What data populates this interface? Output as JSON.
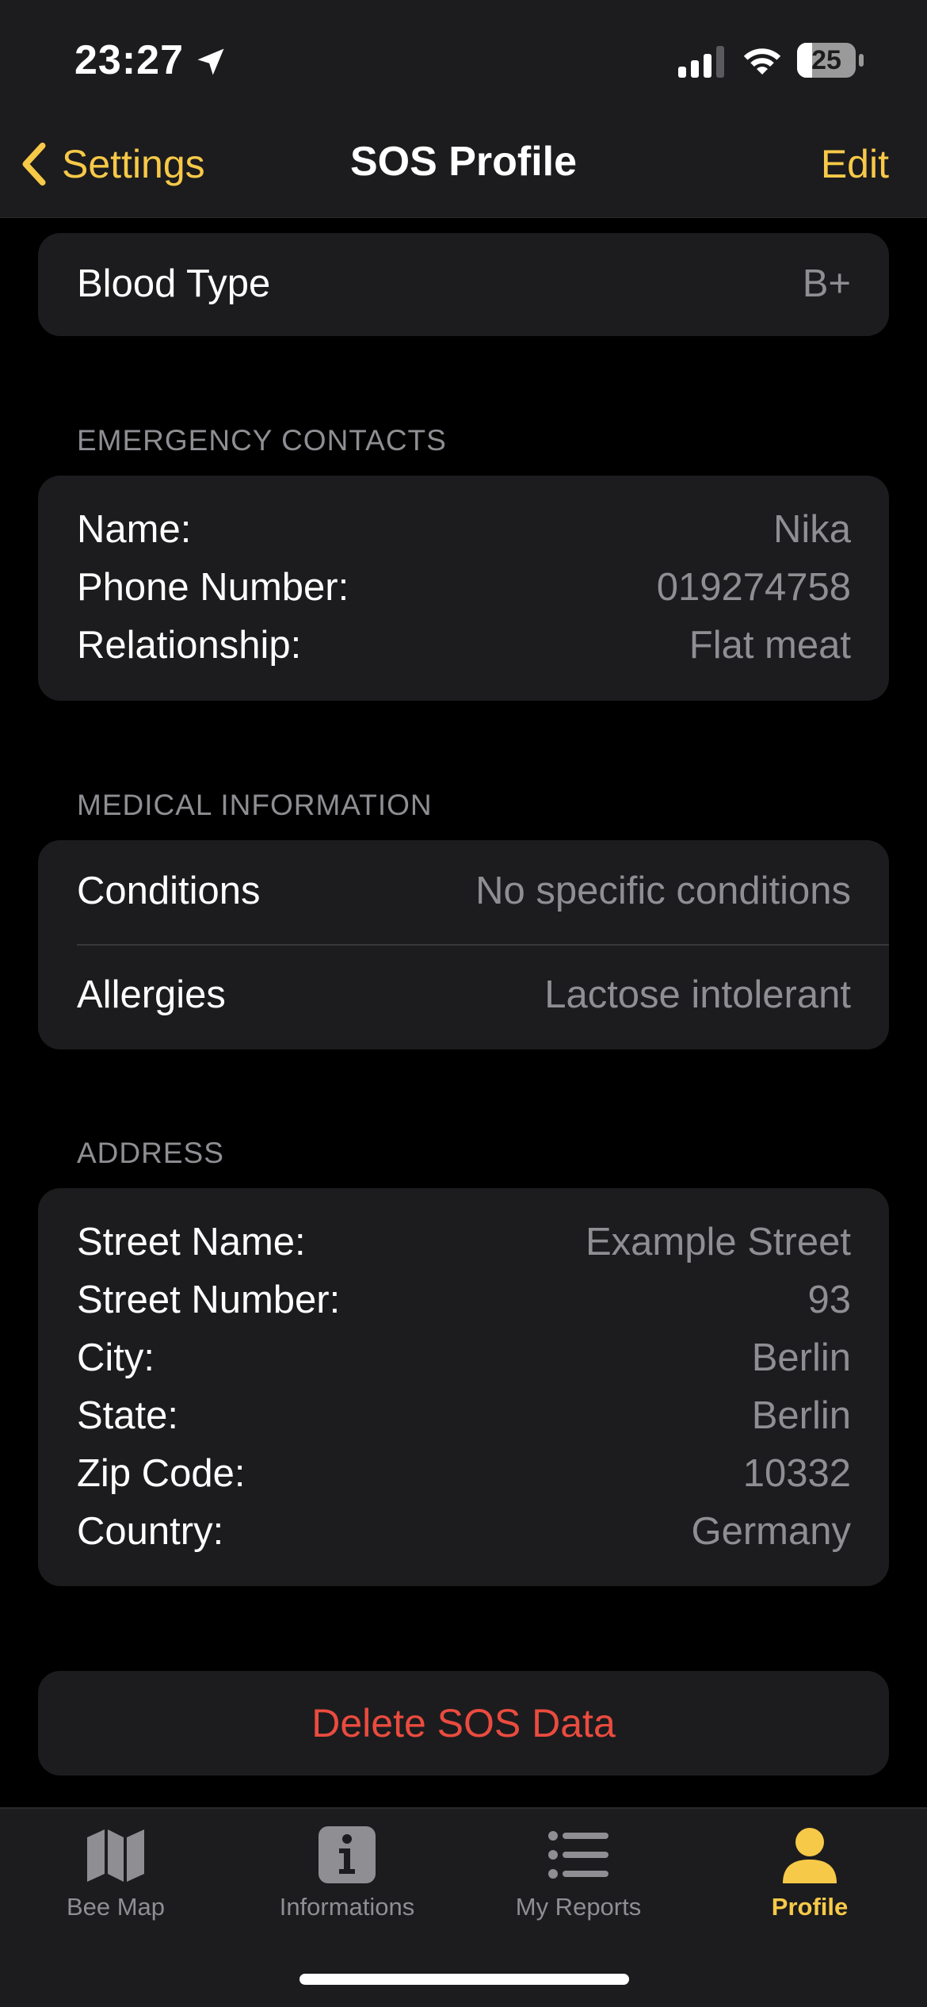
{
  "status_bar": {
    "time": "23:27",
    "battery_text": "25",
    "battery_level": 0.25
  },
  "nav": {
    "back_label": "Settings",
    "title": "SOS Profile",
    "edit_label": "Edit"
  },
  "blood_type": {
    "label": "Blood Type",
    "value": "B+"
  },
  "emergency_contacts": {
    "header": "EMERGENCY CONTACTS",
    "rows": [
      {
        "label": "Name:",
        "value": "Nika"
      },
      {
        "label": "Phone Number:",
        "value": "019274758"
      },
      {
        "label": "Relationship:",
        "value": "Flat meat"
      }
    ]
  },
  "medical_information": {
    "header": "MEDICAL INFORMATION",
    "rows": [
      {
        "label": "Conditions",
        "value": "No specific conditions"
      },
      {
        "label": "Allergies",
        "value": "Lactose intolerant"
      }
    ]
  },
  "address": {
    "header": "ADDRESS",
    "rows": [
      {
        "label": "Street Name:",
        "value": "Example Street"
      },
      {
        "label": "Street Number:",
        "value": "93"
      },
      {
        "label": "City:",
        "value": "Berlin"
      },
      {
        "label": "State:",
        "value": "Berlin"
      },
      {
        "label": "Zip Code:",
        "value": "10332"
      },
      {
        "label": "Country:",
        "value": "Germany"
      }
    ]
  },
  "delete_button": "Delete SOS Data",
  "tabs": [
    {
      "label": "Bee Map",
      "icon": "map-icon",
      "active": false
    },
    {
      "label": "Informations",
      "icon": "info-icon",
      "active": false
    },
    {
      "label": "My Reports",
      "icon": "list-icon",
      "active": false
    },
    {
      "label": "Profile",
      "icon": "person-icon",
      "active": true
    }
  ],
  "colors": {
    "accent": "#f7c948",
    "destructive": "#eb4b3f",
    "background": "#000000",
    "card": "#1c1c1e",
    "secondary_text": "#8e8e93"
  }
}
